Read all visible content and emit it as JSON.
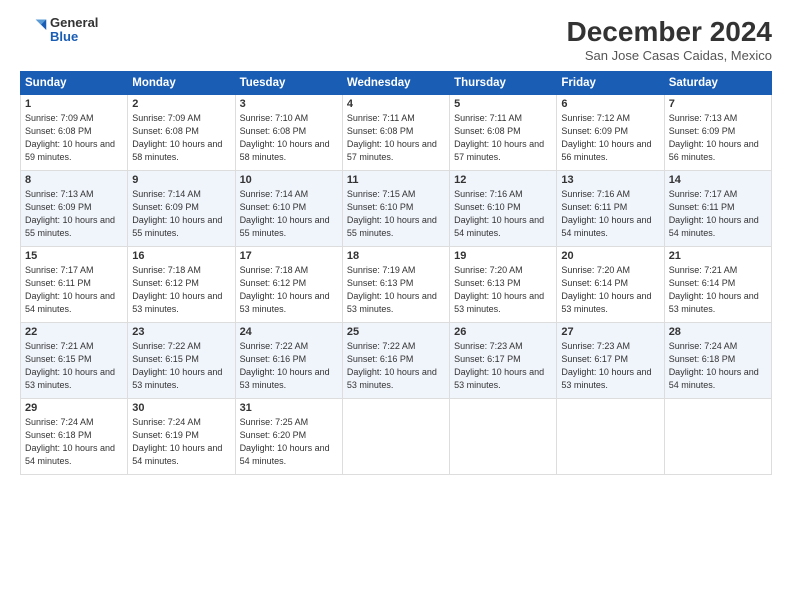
{
  "logo": {
    "general": "General",
    "blue": "Blue"
  },
  "title": "December 2024",
  "subtitle": "San Jose Casas Caidas, Mexico",
  "days_of_week": [
    "Sunday",
    "Monday",
    "Tuesday",
    "Wednesday",
    "Thursday",
    "Friday",
    "Saturday"
  ],
  "weeks": [
    [
      {
        "day": "1",
        "sunrise": "7:09 AM",
        "sunset": "6:08 PM",
        "daylight": "10 hours and 59 minutes."
      },
      {
        "day": "2",
        "sunrise": "7:09 AM",
        "sunset": "6:08 PM",
        "daylight": "10 hours and 58 minutes."
      },
      {
        "day": "3",
        "sunrise": "7:10 AM",
        "sunset": "6:08 PM",
        "daylight": "10 hours and 58 minutes."
      },
      {
        "day": "4",
        "sunrise": "7:11 AM",
        "sunset": "6:08 PM",
        "daylight": "10 hours and 57 minutes."
      },
      {
        "day": "5",
        "sunrise": "7:11 AM",
        "sunset": "6:08 PM",
        "daylight": "10 hours and 57 minutes."
      },
      {
        "day": "6",
        "sunrise": "7:12 AM",
        "sunset": "6:09 PM",
        "daylight": "10 hours and 56 minutes."
      },
      {
        "day": "7",
        "sunrise": "7:13 AM",
        "sunset": "6:09 PM",
        "daylight": "10 hours and 56 minutes."
      }
    ],
    [
      {
        "day": "8",
        "sunrise": "7:13 AM",
        "sunset": "6:09 PM",
        "daylight": "10 hours and 55 minutes."
      },
      {
        "day": "9",
        "sunrise": "7:14 AM",
        "sunset": "6:09 PM",
        "daylight": "10 hours and 55 minutes."
      },
      {
        "day": "10",
        "sunrise": "7:14 AM",
        "sunset": "6:10 PM",
        "daylight": "10 hours and 55 minutes."
      },
      {
        "day": "11",
        "sunrise": "7:15 AM",
        "sunset": "6:10 PM",
        "daylight": "10 hours and 55 minutes."
      },
      {
        "day": "12",
        "sunrise": "7:16 AM",
        "sunset": "6:10 PM",
        "daylight": "10 hours and 54 minutes."
      },
      {
        "day": "13",
        "sunrise": "7:16 AM",
        "sunset": "6:11 PM",
        "daylight": "10 hours and 54 minutes."
      },
      {
        "day": "14",
        "sunrise": "7:17 AM",
        "sunset": "6:11 PM",
        "daylight": "10 hours and 54 minutes."
      }
    ],
    [
      {
        "day": "15",
        "sunrise": "7:17 AM",
        "sunset": "6:11 PM",
        "daylight": "10 hours and 54 minutes."
      },
      {
        "day": "16",
        "sunrise": "7:18 AM",
        "sunset": "6:12 PM",
        "daylight": "10 hours and 53 minutes."
      },
      {
        "day": "17",
        "sunrise": "7:18 AM",
        "sunset": "6:12 PM",
        "daylight": "10 hours and 53 minutes."
      },
      {
        "day": "18",
        "sunrise": "7:19 AM",
        "sunset": "6:13 PM",
        "daylight": "10 hours and 53 minutes."
      },
      {
        "day": "19",
        "sunrise": "7:20 AM",
        "sunset": "6:13 PM",
        "daylight": "10 hours and 53 minutes."
      },
      {
        "day": "20",
        "sunrise": "7:20 AM",
        "sunset": "6:14 PM",
        "daylight": "10 hours and 53 minutes."
      },
      {
        "day": "21",
        "sunrise": "7:21 AM",
        "sunset": "6:14 PM",
        "daylight": "10 hours and 53 minutes."
      }
    ],
    [
      {
        "day": "22",
        "sunrise": "7:21 AM",
        "sunset": "6:15 PM",
        "daylight": "10 hours and 53 minutes."
      },
      {
        "day": "23",
        "sunrise": "7:22 AM",
        "sunset": "6:15 PM",
        "daylight": "10 hours and 53 minutes."
      },
      {
        "day": "24",
        "sunrise": "7:22 AM",
        "sunset": "6:16 PM",
        "daylight": "10 hours and 53 minutes."
      },
      {
        "day": "25",
        "sunrise": "7:22 AM",
        "sunset": "6:16 PM",
        "daylight": "10 hours and 53 minutes."
      },
      {
        "day": "26",
        "sunrise": "7:23 AM",
        "sunset": "6:17 PM",
        "daylight": "10 hours and 53 minutes."
      },
      {
        "day": "27",
        "sunrise": "7:23 AM",
        "sunset": "6:17 PM",
        "daylight": "10 hours and 53 minutes."
      },
      {
        "day": "28",
        "sunrise": "7:24 AM",
        "sunset": "6:18 PM",
        "daylight": "10 hours and 54 minutes."
      }
    ],
    [
      {
        "day": "29",
        "sunrise": "7:24 AM",
        "sunset": "6:18 PM",
        "daylight": "10 hours and 54 minutes."
      },
      {
        "day": "30",
        "sunrise": "7:24 AM",
        "sunset": "6:19 PM",
        "daylight": "10 hours and 54 minutes."
      },
      {
        "day": "31",
        "sunrise": "7:25 AM",
        "sunset": "6:20 PM",
        "daylight": "10 hours and 54 minutes."
      },
      null,
      null,
      null,
      null
    ]
  ]
}
